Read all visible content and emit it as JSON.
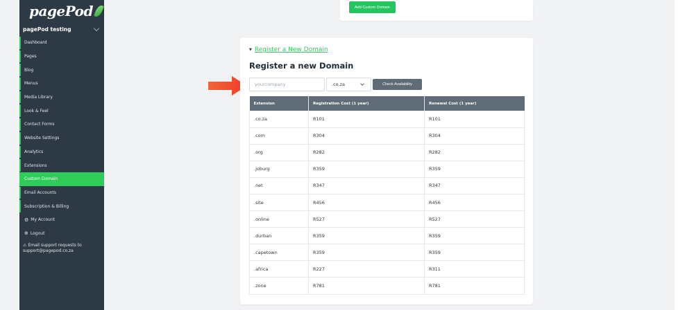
{
  "sidebar": {
    "logo": "pagePod",
    "site_selector": "pagePod testing",
    "items": [
      {
        "label": "Dashboard"
      },
      {
        "label": "Pages"
      },
      {
        "label": "Blog"
      },
      {
        "label": "Menus"
      },
      {
        "label": "Media Library"
      },
      {
        "label": "Look & Feel"
      },
      {
        "label": "Contact Forms"
      },
      {
        "label": "Website Settings"
      },
      {
        "label": "Analytics"
      },
      {
        "label": "Extensions"
      },
      {
        "label": "Custom Domain"
      },
      {
        "label": "Email Accounts"
      },
      {
        "label": "Subscription & Billing"
      },
      {
        "label": "My Account"
      },
      {
        "label": "Logout"
      }
    ],
    "support_line1": "Email support requests to",
    "support_line2": "support@pagepod.co.za",
    "active_color": "#2ecc59",
    "bg_color": "#2d3a45"
  },
  "top_card": {
    "add_button": "Add Custom Domain"
  },
  "register": {
    "toggle_label": "Register a New Domain",
    "heading": "Register a new Domain",
    "input_placeholder": "yourcompany",
    "tld_selected": ".co.za",
    "check_button": "Check Availability",
    "columns": [
      "Extension",
      "Registration Cost (1 year)",
      "Renewal Cost (1 year)"
    ],
    "rows": [
      [
        ".co.za",
        "R101",
        "R101"
      ],
      [
        ".com",
        "R304",
        "R304"
      ],
      [
        ".org",
        "R282",
        "R282"
      ],
      [
        ".joburg",
        "R359",
        "R359"
      ],
      [
        ".net",
        "R347",
        "R347"
      ],
      [
        ".site",
        "R456",
        "R456"
      ],
      [
        ".online",
        "R527",
        "R527"
      ],
      [
        ".durban",
        "R359",
        "R359"
      ],
      [
        ".capetown",
        "R359",
        "R359"
      ],
      [
        ".africa",
        "R227",
        "R311"
      ],
      [
        ".zone",
        "R781",
        "R781"
      ]
    ]
  }
}
